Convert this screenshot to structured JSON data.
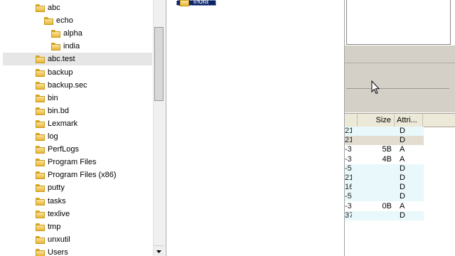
{
  "tree": {
    "items": [
      {
        "label": "abc",
        "indent": 1,
        "selected": false
      },
      {
        "label": "echo",
        "indent": 2,
        "selected": false
      },
      {
        "label": "alpha",
        "indent": 3,
        "selected": false
      },
      {
        "label": "india",
        "indent": 3,
        "selected": false
      },
      {
        "label": "abc.test",
        "indent": 1,
        "selected": true
      },
      {
        "label": "backup",
        "indent": 1,
        "selected": false
      },
      {
        "label": "backup.sec",
        "indent": 1,
        "selected": false
      },
      {
        "label": "bin",
        "indent": 1,
        "selected": false
      },
      {
        "label": "bin.bd",
        "indent": 1,
        "selected": false
      },
      {
        "label": "Lexmark",
        "indent": 1,
        "selected": false
      },
      {
        "label": "log",
        "indent": 1,
        "selected": false
      },
      {
        "label": "PerfLogs",
        "indent": 1,
        "selected": false
      },
      {
        "label": "Program Files",
        "indent": 1,
        "selected": false
      },
      {
        "label": "Program Files (x86)",
        "indent": 1,
        "selected": false
      },
      {
        "label": "putty",
        "indent": 1,
        "selected": false
      },
      {
        "label": "tasks",
        "indent": 1,
        "selected": false
      },
      {
        "label": "texlive",
        "indent": 1,
        "selected": false
      },
      {
        "label": "tmp",
        "indent": 1,
        "selected": false
      },
      {
        "label": "unxutil",
        "indent": 1,
        "selected": false
      },
      {
        "label": "Users",
        "indent": 1,
        "selected": false
      }
    ]
  },
  "middle": {
    "selected_label": "india"
  },
  "file_list": {
    "columns": [
      {
        "key": "date",
        "label": ""
      },
      {
        "key": "size",
        "label": "Size"
      },
      {
        "key": "attr",
        "label": "Attri..."
      }
    ],
    "rows": [
      {
        "date": "21",
        "size": "",
        "attr": "D",
        "tint": "light-blue"
      },
      {
        "date": "21",
        "size": "",
        "attr": "D",
        "tint": "light-tan"
      },
      {
        "date": "-3",
        "size": "5B",
        "attr": "A",
        "tint": "white"
      },
      {
        "date": "-3",
        "size": "4B",
        "attr": "A",
        "tint": "white"
      },
      {
        "date": "-5",
        "size": "",
        "attr": "D",
        "tint": "light-blue"
      },
      {
        "date": "21",
        "size": "",
        "attr": "D",
        "tint": "light-blue"
      },
      {
        "date": "16",
        "size": "",
        "attr": "D",
        "tint": "light-blue"
      },
      {
        "date": "-5",
        "size": "",
        "attr": "D",
        "tint": "light-blue"
      },
      {
        "date": "-3",
        "size": "0B",
        "attr": "A",
        "tint": "white"
      },
      {
        "date": "37",
        "size": "",
        "attr": "D",
        "tint": "light-blue"
      }
    ]
  },
  "colors": {
    "light-blue": "#e8f8fb",
    "light-tan": "#e2ddd0",
    "white": "#ffffff",
    "selection": "#0a246a"
  },
  "icons": {
    "folder": "folder-icon",
    "cursor": "arrow-cursor-icon",
    "scroll_down": "scroll-down-arrow-icon"
  }
}
